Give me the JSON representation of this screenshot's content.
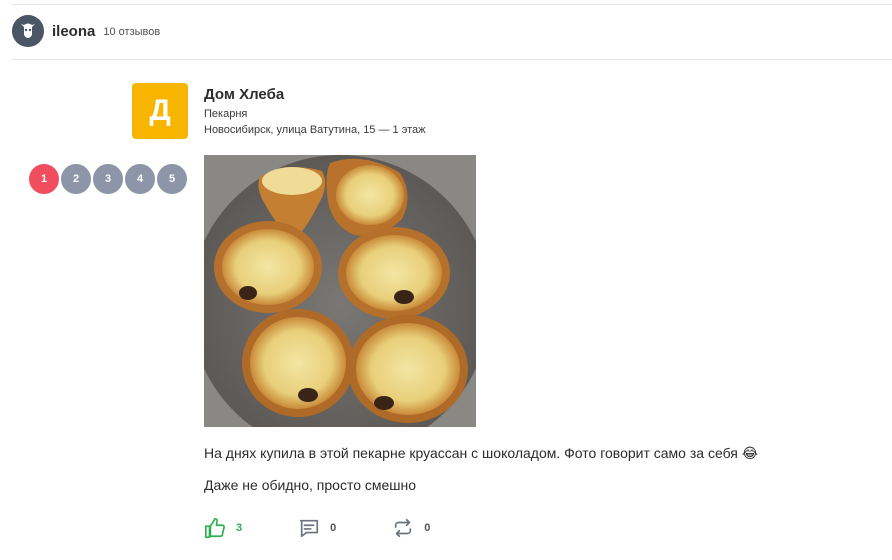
{
  "user": {
    "name": "ileona",
    "reviews_count": "10 отзывов"
  },
  "place": {
    "logo_letter": "Д",
    "logo_color": "#f7b500",
    "name": "Дом Хлеба",
    "category": "Пекарня",
    "address": "Новосибирск, улица Ватутина, 15 — 1 этаж"
  },
  "rating": {
    "value": 1,
    "max": 5,
    "labels": [
      "1",
      "2",
      "3",
      "4",
      "5"
    ],
    "active_color": "#f04e5e",
    "inactive_color": "#8c96a8"
  },
  "photo": {
    "icon": "croissant-photo"
  },
  "review": {
    "line1": "На днях купила в этой пекарне круассан с шоколадом. Фото говорит само за себя 😂",
    "line2": "Даже не обидно, просто смешно"
  },
  "actions": {
    "likes": "3",
    "comments": "0",
    "reposts": "0",
    "like_color": "#2eae4d"
  }
}
